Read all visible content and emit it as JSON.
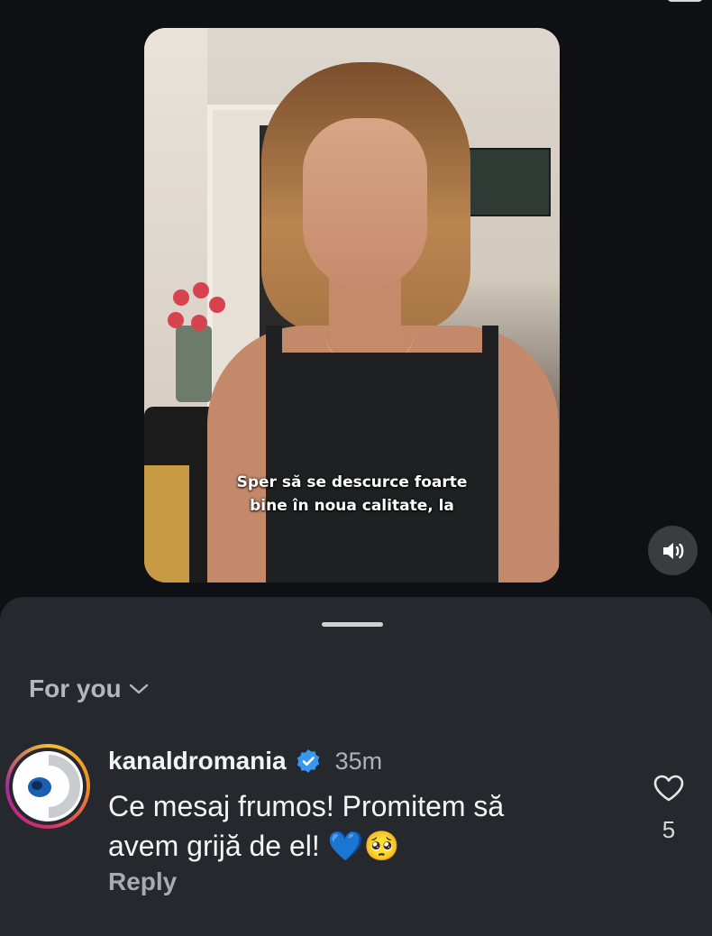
{
  "video": {
    "subtitle_line1": "Sper să se descurce foarte",
    "subtitle_line2": "bine în noua calitate, la",
    "sound_icon": "speaker-volume-icon"
  },
  "comments_sheet": {
    "filter_label": "For you",
    "filter_icon": "chevron-down-icon",
    "comment": {
      "username": "kanaldromania",
      "verified_icon": "verified-badge-icon",
      "timestamp": "35m",
      "text_line1": "Ce mesaj frumos! Promitem să",
      "text_line2": "avem grijă de el! 💙🥺",
      "reply_label": "Reply",
      "like_icon": "heart-icon",
      "like_count": "5"
    }
  },
  "colors": {
    "background": "#0e1014",
    "sheet": "#25282d",
    "verified": "#3897f0",
    "muted_text": "#aeb2b8"
  }
}
